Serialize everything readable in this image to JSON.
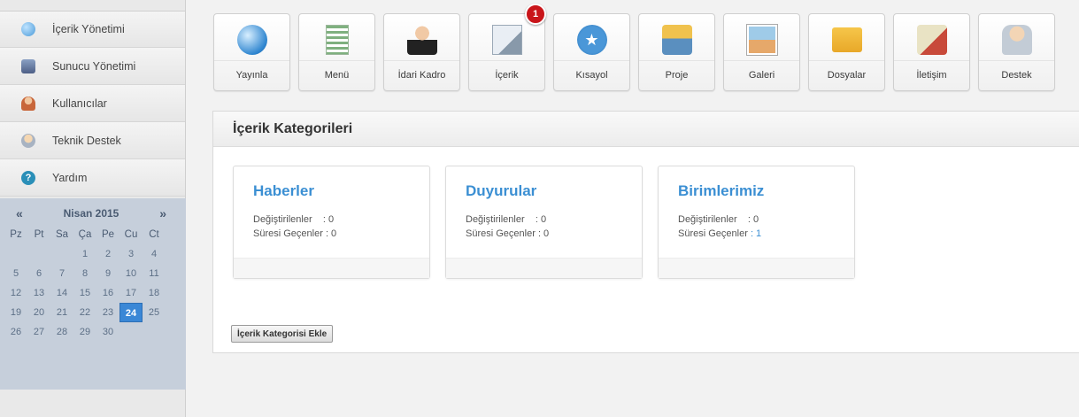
{
  "sidebar": {
    "items": [
      {
        "label": "İçerik Yönetimi",
        "icon": "globe-icon",
        "color": "#5aa7e0"
      },
      {
        "label": "Sunucu Yönetimi",
        "icon": "server-icon",
        "color": "#6b7fa8"
      },
      {
        "label": "Kullanıcılar",
        "icon": "users-icon",
        "color": "#d9875a"
      },
      {
        "label": "Teknik Destek",
        "icon": "support-icon",
        "color": "#d7a86a"
      },
      {
        "label": "Yardım",
        "icon": "help-icon",
        "color": "#2a8fb8"
      }
    ]
  },
  "calendar": {
    "prev": "«",
    "next": "»",
    "month_label": "Nisan 2015",
    "weekdays": [
      "Pz",
      "Pt",
      "Sa",
      "Ça",
      "Pe",
      "Cu",
      "Ct"
    ],
    "leading_blanks": 3,
    "days": [
      "1",
      "2",
      "3",
      "4",
      "5",
      "6",
      "7",
      "8",
      "9",
      "10",
      "11",
      "12",
      "13",
      "14",
      "15",
      "16",
      "17",
      "18",
      "19",
      "20",
      "21",
      "22",
      "23",
      "24",
      "25",
      "26",
      "27",
      "28",
      "29",
      "30"
    ],
    "selected_day": "24"
  },
  "toolbar": {
    "items": [
      {
        "label": "Yayınla",
        "icon": "globe-icon"
      },
      {
        "label": "Menü",
        "icon": "menu-list-icon"
      },
      {
        "label": "İdari Kadro",
        "icon": "businessman-icon"
      },
      {
        "label": "İçerik",
        "icon": "document-edit-icon",
        "badge": "1"
      },
      {
        "label": "Kısayol",
        "icon": "star-icon"
      },
      {
        "label": "Proje",
        "icon": "project-icon"
      },
      {
        "label": "Galeri",
        "icon": "gallery-icon"
      },
      {
        "label": "Dosyalar",
        "icon": "folder-icon"
      },
      {
        "label": "İletişim",
        "icon": "map-pin-icon"
      },
      {
        "label": "Destek",
        "icon": "support-person-icon"
      }
    ]
  },
  "panel": {
    "title": "İçerik Kategorileri",
    "cards": [
      {
        "title": "Haberler",
        "changed_label": "Değiştirilenler",
        "changed_value": ": 0",
        "expired_label": "Süresi Geçenler",
        "expired_value": ": 0"
      },
      {
        "title": "Duyurular",
        "changed_label": "Değiştirilenler",
        "changed_value": ": 0",
        "expired_label": "Süresi Geçenler",
        "expired_value": ": 0"
      },
      {
        "title": "Birimlerimiz",
        "changed_label": "Değiştirilenler",
        "changed_value": ": 0",
        "expired_label": "Süresi Geçenler",
        "expired_value": ": 1"
      }
    ],
    "add_button": "İçerik Kategorisi Ekle"
  },
  "colors": {
    "accent": "#3b8fd3",
    "badge": "#c9151a",
    "calendar_bg": "#c6cfdb",
    "today": "#3a87d6"
  }
}
